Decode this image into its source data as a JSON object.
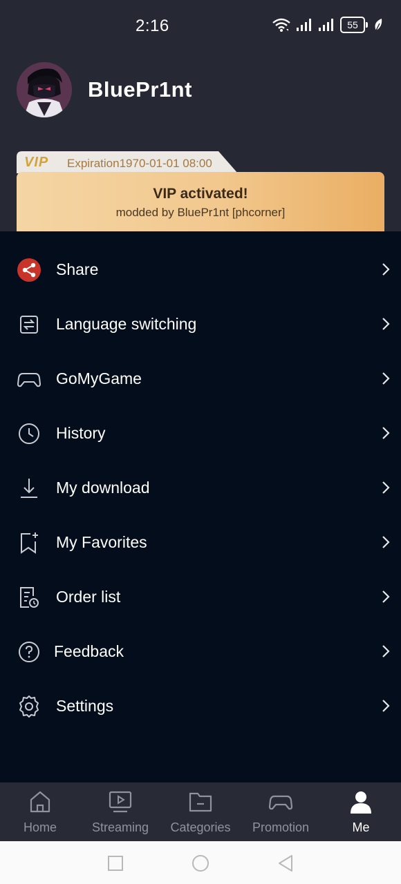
{
  "status_bar": {
    "time": "2:16",
    "battery": "55"
  },
  "profile": {
    "username": "BluePr1nt"
  },
  "vip": {
    "logo": "VIP",
    "expiration": "Expiration1970-01-01 08:00",
    "title": "VIP activated!",
    "subtitle": "modded by BluePr1nt [phcorner]"
  },
  "menu": [
    {
      "label": "Share",
      "icon": "share-icon"
    },
    {
      "label": "Language switching",
      "icon": "language-switch-icon"
    },
    {
      "label": "GoMyGame",
      "icon": "gamepad-icon"
    },
    {
      "label": "History",
      "icon": "clock-icon"
    },
    {
      "label": "My download",
      "icon": "download-icon"
    },
    {
      "label": "My Favorites",
      "icon": "bookmark-plus-icon"
    },
    {
      "label": "Order list",
      "icon": "order-list-icon"
    },
    {
      "label": "Feedback",
      "icon": "question-icon"
    },
    {
      "label": "Settings",
      "icon": "gear-icon"
    }
  ],
  "tabs": [
    {
      "label": "Home",
      "icon": "home-icon",
      "active": false
    },
    {
      "label": "Streaming",
      "icon": "play-screen-icon",
      "active": false
    },
    {
      "label": "Categories",
      "icon": "folder-icon",
      "active": false
    },
    {
      "label": "Promotion",
      "icon": "gamepad-icon",
      "active": false
    },
    {
      "label": "Me",
      "icon": "person-icon",
      "active": true
    }
  ],
  "colors": {
    "header_bg": "#262834",
    "page_bg": "#040d1b",
    "vip_gold": "#f2c88e",
    "share_red": "#c9342a",
    "tab_inactive": "#8f939b"
  }
}
